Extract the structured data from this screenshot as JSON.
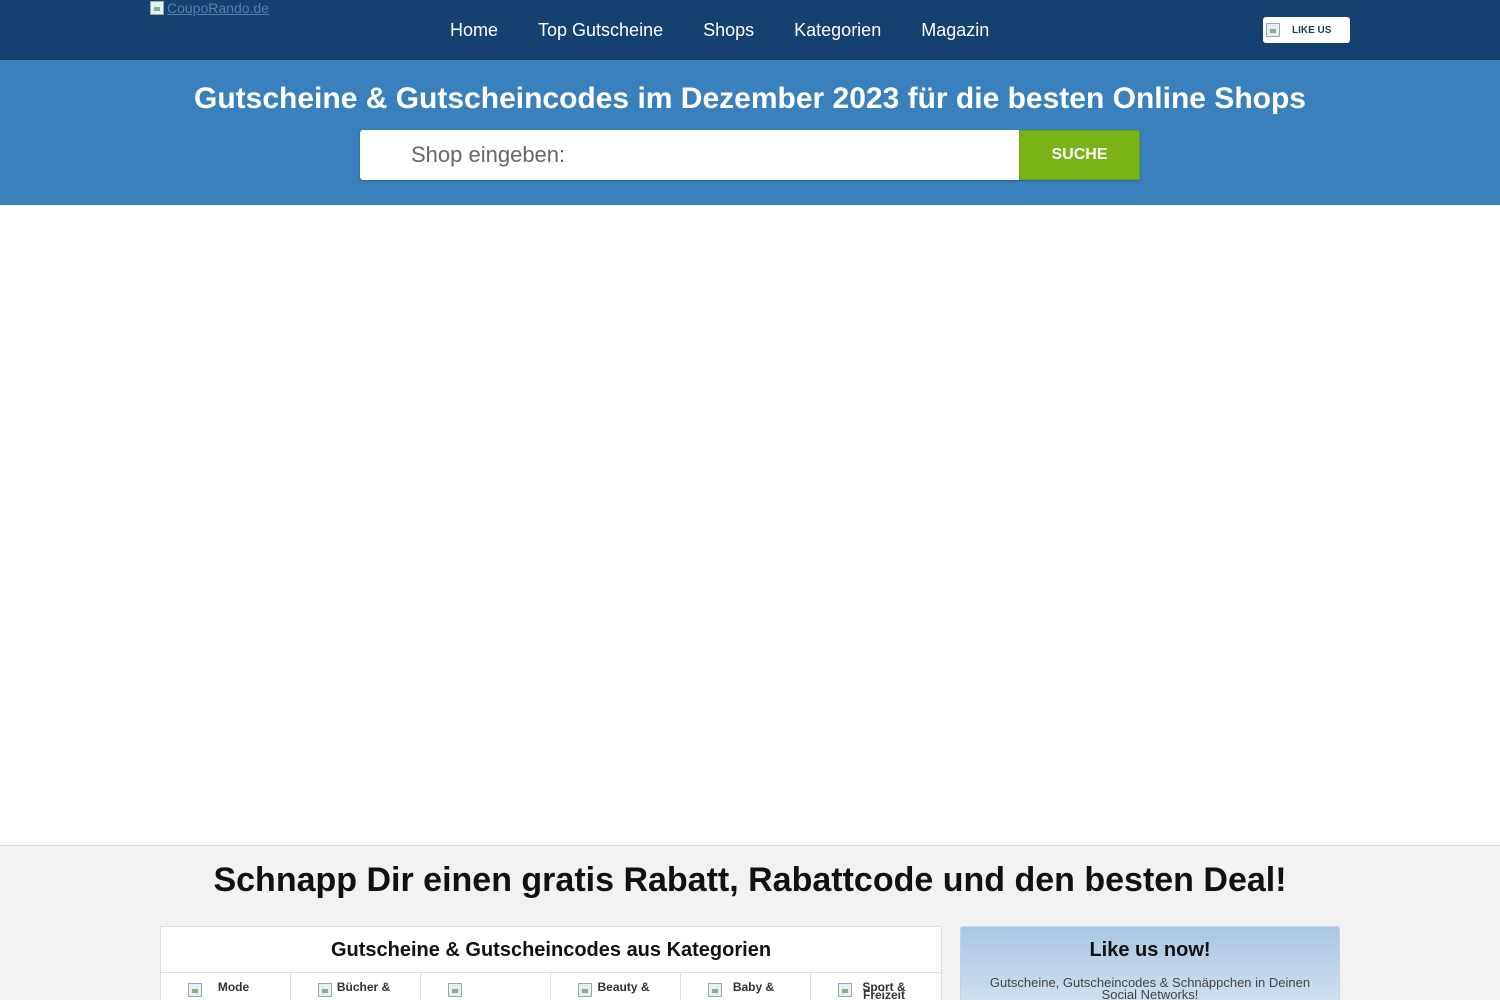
{
  "header": {
    "logo_alt": "CoupoRando.de",
    "nav": [
      "Home",
      "Top Gutscheine",
      "Shops",
      "Kategorien",
      "Magazin"
    ],
    "like_button": "LIKE US"
  },
  "hero": {
    "title": "Gutscheine & Gutscheincodes im Dezember 2023 für die besten Online Shops",
    "search_placeholder": "Shop eingeben:",
    "search_button": "SUCHE"
  },
  "lower": {
    "title": "Schnapp Dir einen gratis Rabatt, Rabattcode und den besten Deal!",
    "categories": {
      "title": "Gutscheine & Gutscheincodes aus Kategorien",
      "items": [
        "Mode",
        "Bücher &",
        "",
        "Beauty &",
        "Baby &",
        "Sport & Freizeit"
      ]
    },
    "like_box": {
      "title": "Like us now!",
      "text": "Gutscheine, Gutscheincodes & Schnäppchen in Deinen Social Networks!"
    }
  },
  "colors": {
    "header_bg": "#154170",
    "hero_bg": "#3a80bd",
    "search_button_bg": "#7ab317",
    "lower_bg": "#f2f2f2"
  }
}
